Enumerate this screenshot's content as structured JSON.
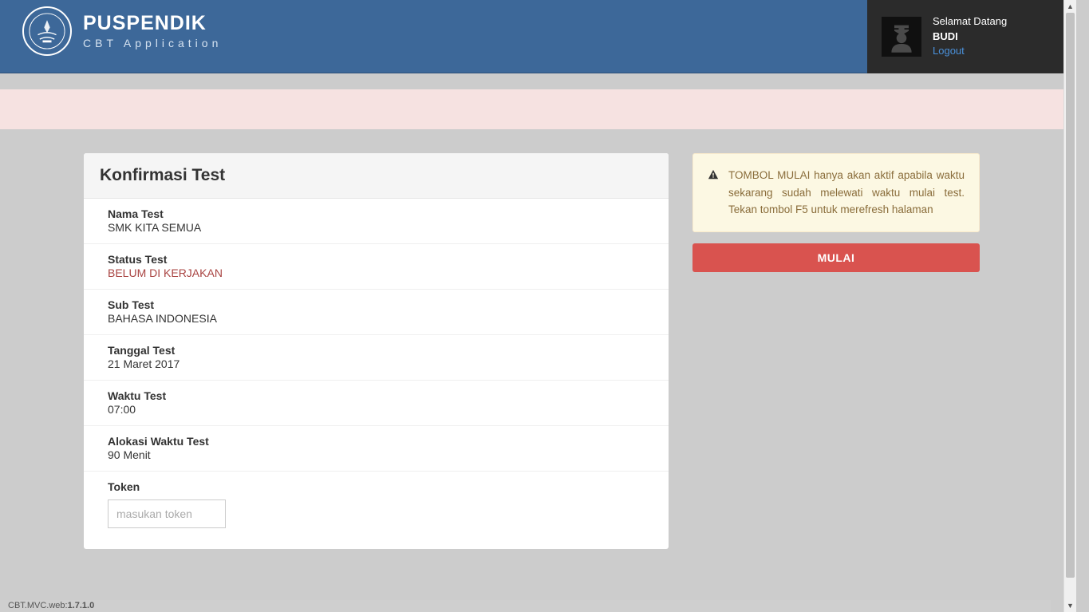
{
  "header": {
    "brand_title": "PUSPENDIK",
    "brand_sub": "CBT Application",
    "welcome": "Selamat Datang",
    "user_name": "BUDI",
    "logout": "Logout"
  },
  "card": {
    "title": "Konfirmasi Test",
    "fields": [
      {
        "label": "Nama Test",
        "value": "SMK KITA SEMUA",
        "red": false
      },
      {
        "label": "Status Test",
        "value": "BELUM DI KERJAKAN",
        "red": true
      },
      {
        "label": "Sub Test",
        "value": "BAHASA INDONESIA",
        "red": false
      },
      {
        "label": "Tanggal Test",
        "value": "21 Maret 2017",
        "red": false
      },
      {
        "label": "Waktu Test",
        "value": "07:00",
        "red": false
      },
      {
        "label": "Alokasi Waktu Test",
        "value": "90 Menit",
        "red": false
      }
    ],
    "token_label": "Token",
    "token_placeholder": "masukan token"
  },
  "alert_text": "TOMBOL MULAI hanya akan aktif apabila waktu sekarang sudah melewati waktu mulai test. Tekan tombol F5 untuk merefresh halaman",
  "mulai_label": "MULAI",
  "footer_prefix": "CBT.MVC.web:",
  "footer_version": "1.7.1.0"
}
